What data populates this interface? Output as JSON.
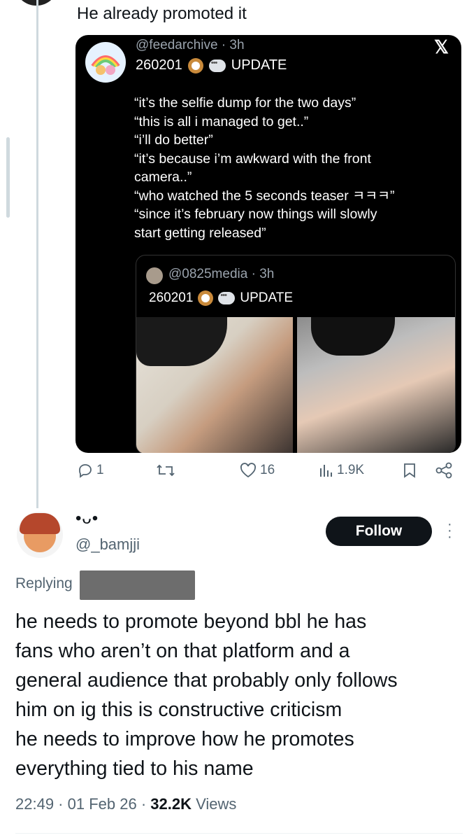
{
  "post": {
    "text": "He already promoted it"
  },
  "card": {
    "handle": "@feedarchive",
    "age": "3h",
    "date": "260201",
    "tag": "UPDATE",
    "quotes": [
      "“it’s the selfie dump for the two days”",
      "“this is all i managed to get..”",
      "“i’ll do better”",
      "“it’s because i’m awkward with the front",
      "camera..”",
      "“who watched the 5 seconds teaser ㅋㅋㅋ”",
      "“since it’s february now things will slowly",
      "start getting released”"
    ],
    "inner": {
      "handle": "@0825media",
      "age": "3h",
      "date": "260201",
      "tag": "UPDATE"
    }
  },
  "actions": {
    "replies": "1",
    "likes": "16",
    "views": "1.9K"
  },
  "reply": {
    "name": "•ᴗ•",
    "handle": "@_bamjji",
    "follow_label": "Follow",
    "replying_label": "Replying",
    "lines": [
      "he needs to promote beyond bbl he has",
      "fans who aren’t on that platform and a",
      "general audience that probably only follows",
      "him on ig this is constructive criticism",
      "he needs to improve how he promotes",
      "everything tied to his name"
    ],
    "time": "22:49",
    "date": "01 Feb 26",
    "views_count": "32.2K",
    "views_label": "Views"
  },
  "icons": {
    "reply": "reply-icon",
    "repost": "repost-icon",
    "like": "heart-icon",
    "views": "analytics-icon",
    "bookmark": "bookmark-icon",
    "share": "share-icon",
    "more": "more-icon"
  }
}
